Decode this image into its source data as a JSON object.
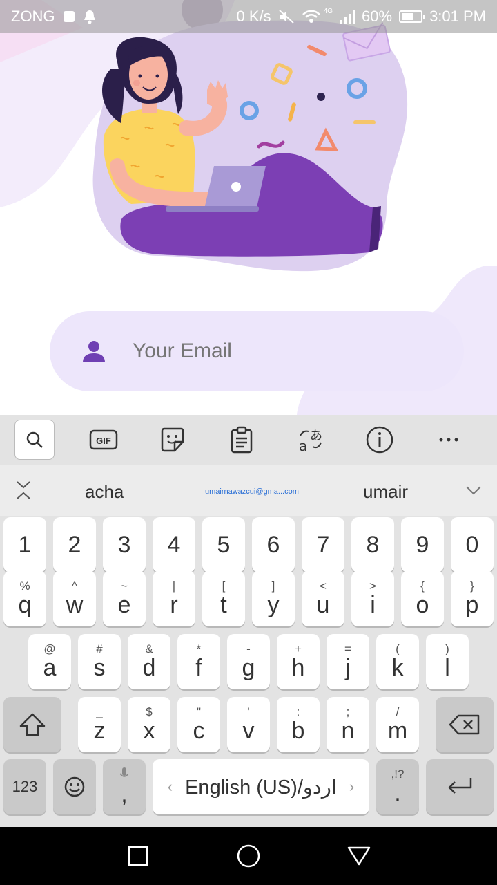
{
  "status_bar": {
    "carrier": "ZONG",
    "net_speed": "0 K/s",
    "network_type": "4G",
    "battery": "60%",
    "battery_level": 0.6,
    "time": "3:01 PM"
  },
  "login": {
    "email_placeholder": "Your Email",
    "email_value": "",
    "icon": "person-icon",
    "accent_color": "#6f3fb3"
  },
  "keyboard": {
    "toolbar": [
      "search-icon",
      "gif-icon",
      "sticker-icon",
      "clipboard-icon",
      "translate-icon",
      "info-icon",
      "more-icon"
    ],
    "gif_label": "GIF",
    "suggestions": {
      "left": "acha",
      "middle": "umairnawazcui@gma...com",
      "right": "umair"
    },
    "row_numbers": [
      "1",
      "2",
      "3",
      "4",
      "5",
      "6",
      "7",
      "8",
      "9",
      "0"
    ],
    "row_q": [
      {
        "main": "q",
        "alt": "%"
      },
      {
        "main": "w",
        "alt": "^"
      },
      {
        "main": "e",
        "alt": "~"
      },
      {
        "main": "r",
        "alt": "|"
      },
      {
        "main": "t",
        "alt": "["
      },
      {
        "main": "y",
        "alt": "]"
      },
      {
        "main": "u",
        "alt": "<"
      },
      {
        "main": "i",
        "alt": ">"
      },
      {
        "main": "o",
        "alt": "{"
      },
      {
        "main": "p",
        "alt": "}"
      }
    ],
    "row_a": [
      {
        "main": "a",
        "alt": "@"
      },
      {
        "main": "s",
        "alt": "#"
      },
      {
        "main": "d",
        "alt": "&"
      },
      {
        "main": "f",
        "alt": "*"
      },
      {
        "main": "g",
        "alt": "-"
      },
      {
        "main": "h",
        "alt": "+"
      },
      {
        "main": "j",
        "alt": "="
      },
      {
        "main": "k",
        "alt": "("
      },
      {
        "main": "l",
        "alt": ")"
      }
    ],
    "row_z": [
      {
        "main": "z",
        "alt": "_"
      },
      {
        "main": "x",
        "alt": "$"
      },
      {
        "main": "c",
        "alt": "\""
      },
      {
        "main": "v",
        "alt": "'"
      },
      {
        "main": "b",
        "alt": ":"
      },
      {
        "main": "n",
        "alt": ";"
      },
      {
        "main": "m",
        "alt": "/"
      }
    ],
    "symbols_label": "123",
    "comma_label": ",",
    "space_label": "English (US)/اردو",
    "period_label": ".",
    "period_alt": ",!?"
  }
}
